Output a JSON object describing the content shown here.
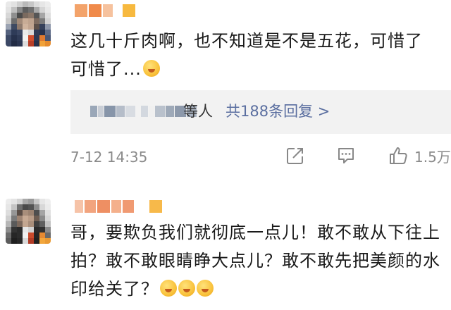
{
  "comments": [
    {
      "text": "这几十斤肉啊，也不知道是不是五花，可惜了 可惜了...",
      "emoji": "yum-emoji",
      "reply_preview": {
        "suffix": "等人",
        "link": "共188条回复 >"
      },
      "time": "7-12 14:35",
      "likes": "1.5万"
    },
    {
      "text": "哥，要欺负我们就彻底一点儿！敢不敢从下往上拍？敢不敢眼睛睁大点儿？敢不敢先把美颜的水印给关了？",
      "emoji": "cover-face-emoji"
    }
  ],
  "icons": {
    "share": "share-icon",
    "comment": "comment-icon",
    "like": "thumbs-up-icon"
  },
  "colors": {
    "link": "#5b6fa0",
    "meta": "#8a8a8a",
    "reply_bg": "#f2f2f2"
  }
}
